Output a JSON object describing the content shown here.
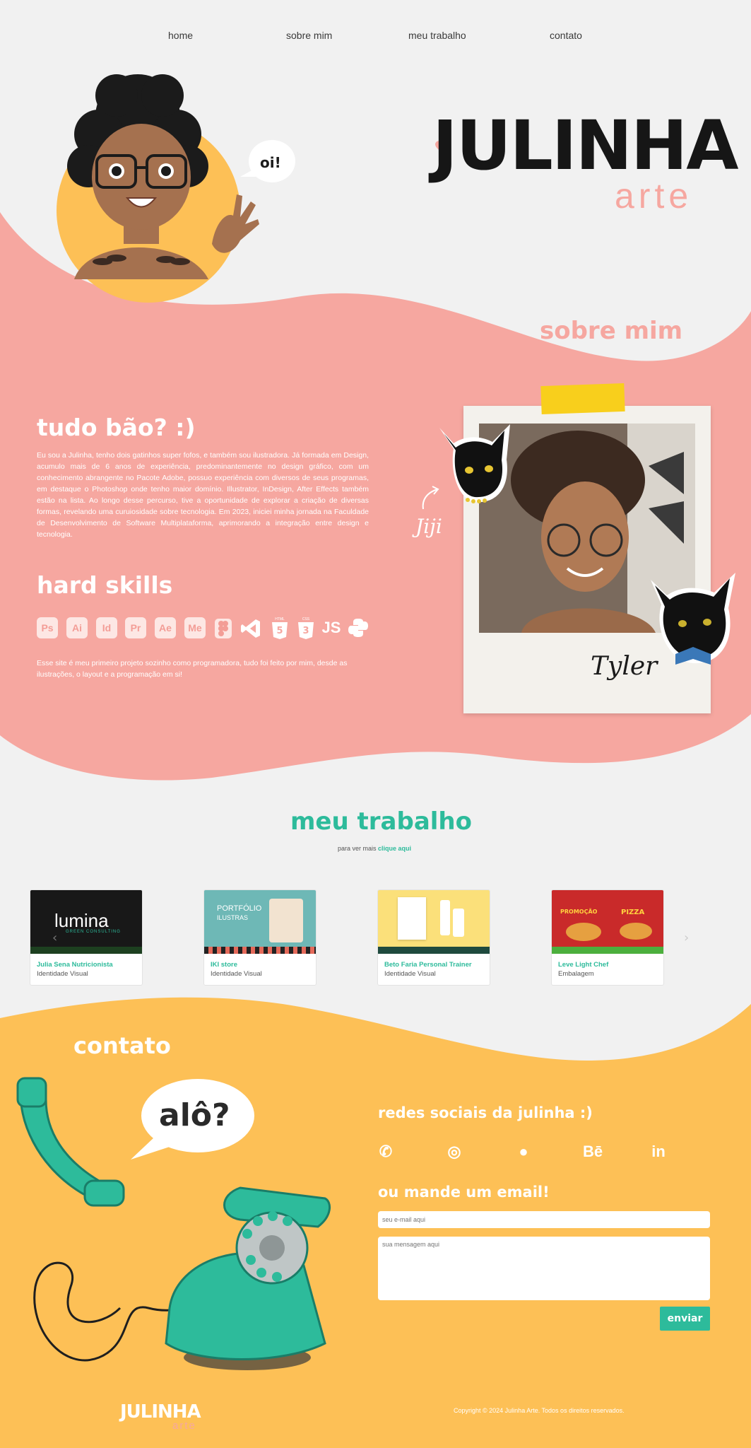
{
  "nav": {
    "home": "home",
    "about": "sobre mim",
    "work": "meu trabalho",
    "contact": "contato"
  },
  "hero": {
    "speech": "oi!",
    "logo_main": "JULINHA",
    "logo_sub": "arte"
  },
  "about": {
    "section_title": "sobre mim",
    "greeting": "tudo bão? :)",
    "bio": "Eu sou a Julinha, tenho dois gatinhos super fofos, e também sou ilustradora. Já formada em Design, acumulo mais de 6 anos de experiência, predominantemente no design gráfico, com um conhecimento abrangente no Pacote Adobe, possuo experiência com diversos de seus programas, em destaque o Photoshop onde tenho maior domínio. Illustrator, InDesign, After Effects também estão na lista. Ao longo desse percurso, tive a oportunidade de explorar a criação de diversas formas, revelando uma curuiosidade sobre tecnologia. Em 2023, iniciei minha jornada na Faculdade de Desenvolvimento de Software Multiplataforma, aprimorando a integração entre design e tecnologia.",
    "skills_title": "hard skills",
    "skills": [
      "Ps",
      "Ai",
      "Id",
      "Pr",
      "Ae",
      "Me"
    ],
    "js_label": "JS",
    "html_label": "HTML",
    "css_label": "CSS",
    "note": "Esse site é meu primeiro projeto sozinho como programadora, tudo foi feito por mim, desde as ilustrações, o layout e a programação em si!",
    "cat1": "Jiji",
    "cat2": "Tyler"
  },
  "work": {
    "title": "meu trabalho",
    "subtitle_prefix": "para ver mais",
    "subtitle_link": "clique aqui",
    "cards": [
      {
        "title": "Julia Sena Nutricionista",
        "category": "Identidade Visual",
        "img_text": "lumina",
        "img_sub": "GREEN CONSULTING"
      },
      {
        "title": "IKI store",
        "category": "Identidade Visual",
        "img_text": "PORTFÓLIO",
        "img_sub": "ILUSTRAS"
      },
      {
        "title": "Beto Faria Personal Trainer",
        "category": "Identidade Visual",
        "img_text": "",
        "img_sub": ""
      },
      {
        "title": "Leve Light Chef",
        "category": "Embalagem",
        "img_text": "PROMOÇÃO",
        "img_sub": "PIZZA"
      }
    ]
  },
  "contact": {
    "title": "contato",
    "bubble": "alô?",
    "social_title": "redes sociais da julinha :)",
    "social": [
      {
        "name": "whatsapp-icon",
        "glyph": "✆"
      },
      {
        "name": "instagram-icon",
        "glyph": "◎"
      },
      {
        "name": "github-icon",
        "glyph": "●"
      },
      {
        "name": "behance-icon",
        "glyph": "Bē"
      },
      {
        "name": "linkedin-icon",
        "glyph": "in"
      }
    ],
    "email_title": "ou mande um email!",
    "email_placeholder": "seu e-mail aqui",
    "message_placeholder": "sua mensagem aqui",
    "send": "enviar"
  },
  "footer": {
    "logo_main": "JULINHA",
    "logo_sub": "arte",
    "copyright": "Copyright © 2024 Julinha Arte. Todos os direitos reservados."
  },
  "colors": {
    "pink": "#f6a7a0",
    "teal": "#2dbb9b",
    "yellow": "#fdc056",
    "dark": "#161616"
  }
}
